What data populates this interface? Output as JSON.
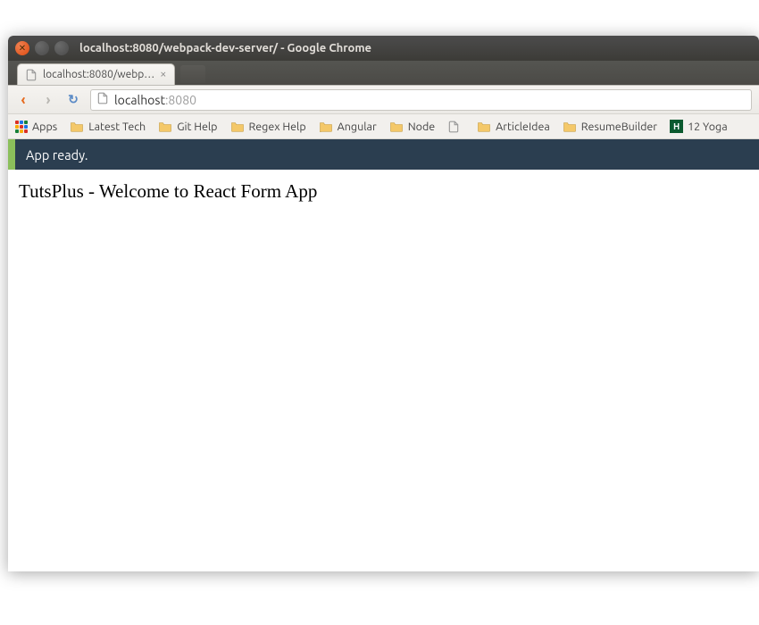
{
  "window": {
    "title": "localhost:8080/webpack-dev-server/ - Google Chrome"
  },
  "tab": {
    "title": "localhost:8080/webp…"
  },
  "address": {
    "host": "localhost",
    "port": ":8080"
  },
  "bookmarks": {
    "apps": "Apps",
    "items": [
      {
        "label": "Latest Tech",
        "type": "folder"
      },
      {
        "label": "Git Help",
        "type": "folder"
      },
      {
        "label": "Regex Help",
        "type": "folder"
      },
      {
        "label": "Angular",
        "type": "folder"
      },
      {
        "label": "Node",
        "type": "folder"
      },
      {
        "label": "",
        "type": "page"
      },
      {
        "label": "ArticleIdea",
        "type": "folder"
      },
      {
        "label": "ResumeBuilder",
        "type": "folder"
      },
      {
        "label": "12 Yoga",
        "type": "h"
      }
    ]
  },
  "status": {
    "text": "App ready."
  },
  "page": {
    "heading": "TutsPlus - Welcome to React Form App"
  }
}
